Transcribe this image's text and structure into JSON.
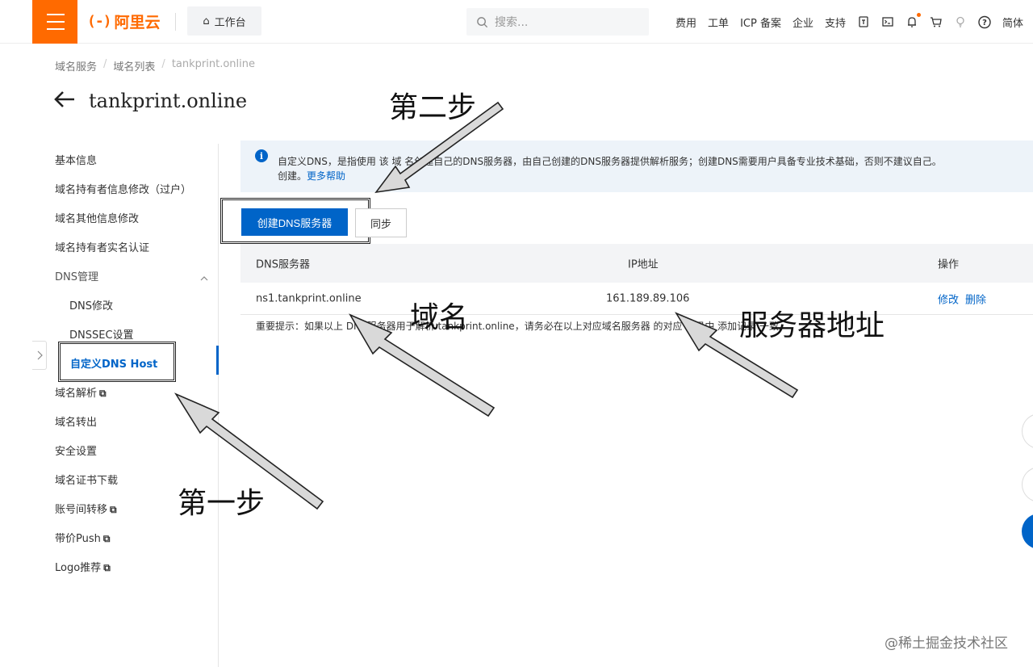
{
  "header": {
    "logo_text": "阿里云",
    "logo_mark": "(-)",
    "workbench_label": "工作台",
    "search_placeholder": "搜索...",
    "nav_items": [
      "费用",
      "工单",
      "ICP 备案",
      "企业",
      "支持"
    ],
    "lang_label": "简体",
    "accent_color": "#ff6a00"
  },
  "breadcrumb": [
    "域名服务",
    "域名列表",
    "tankprint.online"
  ],
  "page": {
    "title": "tankprint.online"
  },
  "sidebar": {
    "items": [
      "基本信息",
      "域名持有者信息修改（过户）",
      "域名其他信息修改",
      "域名持有者实名认证",
      "DNS管理",
      "DNS修改",
      "DNSSEC设置",
      "自定义DNS Host",
      "域名解析",
      "域名转出",
      "安全设置",
      "域名证书下载",
      "账号间转移",
      "带价Push",
      "Logo推荐"
    ],
    "active_item": "自定义DNS Host",
    "active_color": "#0064c8"
  },
  "notice": {
    "line1": "自定义DNS，是指使用 该 域 名创建自己的DNS服务器，由自己创建的DNS服务器提供解析服务；创建DNS需要用户具备专业技术基础，否则不建议自己。",
    "line2_prefix": "创建。",
    "help_link": "更多帮助"
  },
  "actions": {
    "create_label": "创建DNS服务器",
    "sync_label": "同步"
  },
  "table": {
    "columns": [
      "DNS服务器",
      "IP地址",
      "操作"
    ],
    "rows": [
      {
        "server": "ns1.tankprint.online",
        "ip": "161.189.89.106",
        "ops": [
          "修改",
          "删除"
        ]
      }
    ]
  },
  "tip": "重要提示：如果以上 DNS服务器用于解析 tankprint.online，请务必在以上对应域名服务器 的对应 记录中 添加记录 一致。",
  "annotations": {
    "step1": "第一步",
    "step2": "第二步",
    "domain": "域名",
    "server_addr": "服务器地址"
  },
  "watermark": "@稀土掘金技术社区"
}
